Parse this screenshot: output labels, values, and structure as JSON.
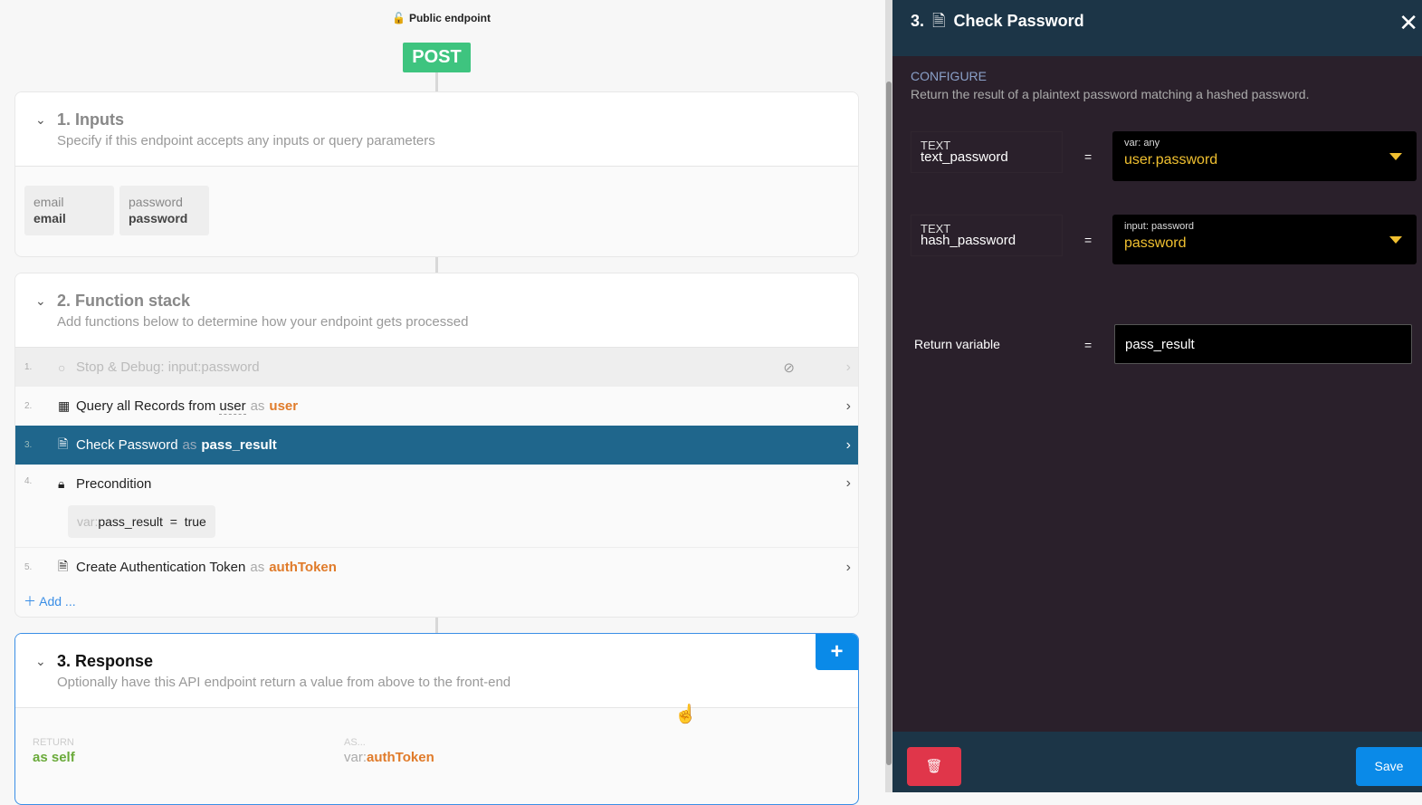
{
  "header": {
    "public_label": "Public endpoint",
    "method": "POST"
  },
  "inputs": {
    "title": "1. Inputs",
    "subtitle": "Specify if this endpoint accepts any inputs or query parameters",
    "items": [
      {
        "type": "email",
        "name": "email"
      },
      {
        "type": "password",
        "name": "password"
      }
    ]
  },
  "stack": {
    "title": "2. Function stack",
    "subtitle": "Add functions below to determine how your endpoint gets processed",
    "items": [
      {
        "num": "1.",
        "label": "Stop & Debug: input:password"
      },
      {
        "num": "2.",
        "label": "Query all Records from",
        "table": "user",
        "as": "as",
        "alias": "user"
      },
      {
        "num": "3.",
        "label": "Check Password",
        "as": "as",
        "alias": "pass_result"
      },
      {
        "num": "4.",
        "label": "Precondition",
        "cond_prefix": "var:",
        "cond_var": "pass_result",
        "cond_op": "=",
        "cond_val": "true"
      },
      {
        "num": "5.",
        "label": "Create Authentication Token",
        "as": "as",
        "alias": "authToken"
      }
    ],
    "add_label": "Add ..."
  },
  "response": {
    "title": "3. Response",
    "subtitle": "Optionally have this API endpoint return a value from above to the front-end",
    "return_label": "RETURN",
    "return_value": "as self",
    "as_label": "AS...",
    "as_prefix": "var:",
    "as_value": "authToken"
  },
  "panel": {
    "num": "3.",
    "title": "Check Password",
    "configure": "CONFIGURE",
    "description": "Return the result of a plaintext password matching a hashed password.",
    "params": [
      {
        "type": "TEXT",
        "name": "text_password",
        "eq": "=",
        "source": "var: any",
        "value": "user.password"
      },
      {
        "type": "TEXT",
        "name": "hash_password",
        "eq": "=",
        "source": "input: password",
        "value": "password"
      }
    ],
    "return_label": "Return variable",
    "return_eq": "=",
    "return_value": "pass_result",
    "save": "Save"
  },
  "colors": {
    "post": "#3ec47f",
    "selected": "#1f668c",
    "accent": "#e07b2a",
    "save": "#0a8ae8",
    "delete": "#e0364a"
  }
}
